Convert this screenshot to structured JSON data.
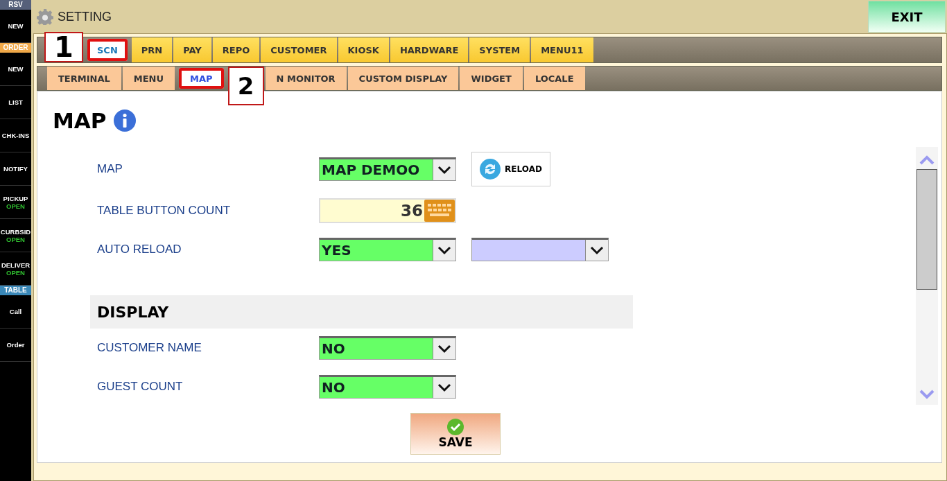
{
  "sidebar": [
    {
      "kind": "header",
      "label": "RSV",
      "color": "#56607a"
    },
    {
      "kind": "button",
      "label": "NEW"
    },
    {
      "kind": "header",
      "label": "ORDER",
      "color": "#f0a848"
    },
    {
      "kind": "button",
      "label": "NEW"
    },
    {
      "kind": "button",
      "label": "LIST"
    },
    {
      "kind": "button",
      "label": "CHK-INS"
    },
    {
      "kind": "button",
      "label": "NOTIFY"
    },
    {
      "kind": "button",
      "label": "PICKUP",
      "status": "OPEN"
    },
    {
      "kind": "button",
      "label": "CURBSID",
      "status": "OPEN"
    },
    {
      "kind": "button",
      "label": "DELIVER",
      "status": "OPEN"
    },
    {
      "kind": "header",
      "label": "TABLE",
      "color": "#3a88b8"
    },
    {
      "kind": "button",
      "label": "Call"
    },
    {
      "kind": "button",
      "label": "Order"
    }
  ],
  "header": {
    "title": "SETTING",
    "exit": "EXIT"
  },
  "main_tabs": {
    "callout": "1",
    "items": [
      {
        "label": "SCN",
        "selected": true
      },
      {
        "label": "PRN",
        "selected": false
      },
      {
        "label": "PAY",
        "selected": false
      },
      {
        "label": "REPO",
        "selected": false
      },
      {
        "label": "CUSTOMER",
        "selected": false
      },
      {
        "label": "KIOSK",
        "selected": false
      },
      {
        "label": "HARDWARE",
        "selected": false
      },
      {
        "label": "SYSTEM",
        "selected": false
      },
      {
        "label": "MENU11",
        "selected": false
      }
    ]
  },
  "sub_tabs": {
    "callout": "2",
    "items": [
      {
        "label": "TERMINAL",
        "selected": false
      },
      {
        "label": "MENU",
        "selected": false
      },
      {
        "label": "MAP",
        "selected": true
      },
      {
        "label": "N MONITOR",
        "selected": false
      },
      {
        "label": "CUSTOM DISPLAY",
        "selected": false
      },
      {
        "label": "WIDGET",
        "selected": false
      },
      {
        "label": "LOCALE",
        "selected": false
      }
    ]
  },
  "page_title": "MAP",
  "settings": [
    {
      "kind": "select",
      "label": "MAP",
      "value": "MAP DEMOO",
      "color": "#66ff66",
      "button": "RELOAD"
    },
    {
      "kind": "number",
      "label": "TABLE BUTTON COUNT",
      "value": "36"
    },
    {
      "kind": "select",
      "label": "AUTO RELOAD",
      "value": "YES",
      "color": "#66ff66",
      "second_select": {
        "color": "#ccccff"
      }
    },
    {
      "kind": "section",
      "label": "DISPLAY"
    },
    {
      "kind": "select",
      "label": "CUSTOMER NAME",
      "value": "NO",
      "color": "#66ff66"
    },
    {
      "kind": "select",
      "label": "GUEST COUNT",
      "value": "NO",
      "color": "#66ff66"
    }
  ],
  "save": "SAVE"
}
